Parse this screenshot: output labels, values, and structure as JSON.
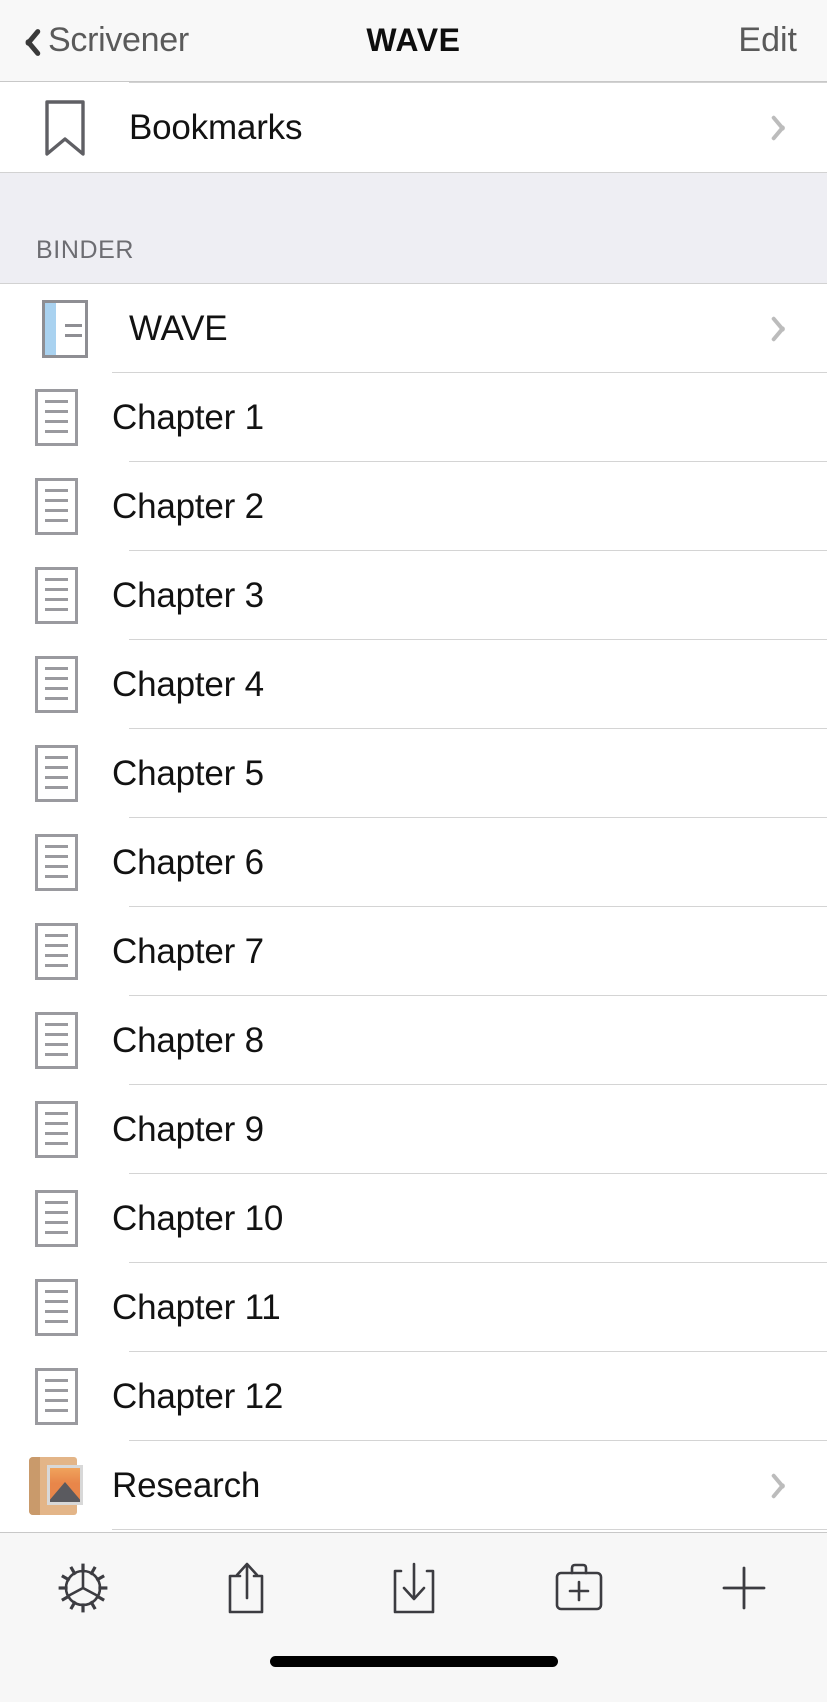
{
  "navbar": {
    "back_label": "Scrivener",
    "back_icon": "chevron-left-icon",
    "title": "WAVE",
    "edit_label": "Edit"
  },
  "bookmarks_row": {
    "label": "Bookmarks",
    "icon": "bookmark-icon",
    "disclosure": "chevron-right-icon"
  },
  "section": {
    "header": "BINDER"
  },
  "binder": {
    "root": {
      "label": "WAVE",
      "icon": "binder-notebook-icon",
      "disclosure": "chevron-right-icon"
    },
    "documents": [
      {
        "label": "Chapter 1",
        "icon": "document-icon"
      },
      {
        "label": "Chapter 2",
        "icon": "document-icon"
      },
      {
        "label": "Chapter 3",
        "icon": "document-icon"
      },
      {
        "label": "Chapter 4",
        "icon": "document-icon"
      },
      {
        "label": "Chapter 5",
        "icon": "document-icon"
      },
      {
        "label": "Chapter 6",
        "icon": "document-icon"
      },
      {
        "label": "Chapter 7",
        "icon": "document-icon"
      },
      {
        "label": "Chapter 8",
        "icon": "document-icon"
      },
      {
        "label": "Chapter 9",
        "icon": "document-icon"
      },
      {
        "label": "Chapter 10",
        "icon": "document-icon"
      },
      {
        "label": "Chapter 11",
        "icon": "document-icon"
      },
      {
        "label": "Chapter 12",
        "icon": "document-icon"
      }
    ],
    "research": {
      "label": "Research",
      "icon": "research-folder-photo-icon",
      "disclosure": "chevron-right-icon"
    }
  },
  "toolbar": {
    "items": [
      {
        "icon": "gear-icon"
      },
      {
        "icon": "share-icon"
      },
      {
        "icon": "import-icon"
      },
      {
        "icon": "new-folder-icon"
      },
      {
        "icon": "plus-icon"
      }
    ]
  },
  "colors": {
    "accent_blue": "#a9d2f0",
    "research_tan": "#e3b588",
    "research_photo_orange": "#e8864a",
    "section_bg": "#eeeef3",
    "nav_bg": "#f8f8f8",
    "toolbar_bg": "#f7f7f7",
    "separator": "#d4d4d4",
    "icon_gray": "#9a9a9f"
  }
}
